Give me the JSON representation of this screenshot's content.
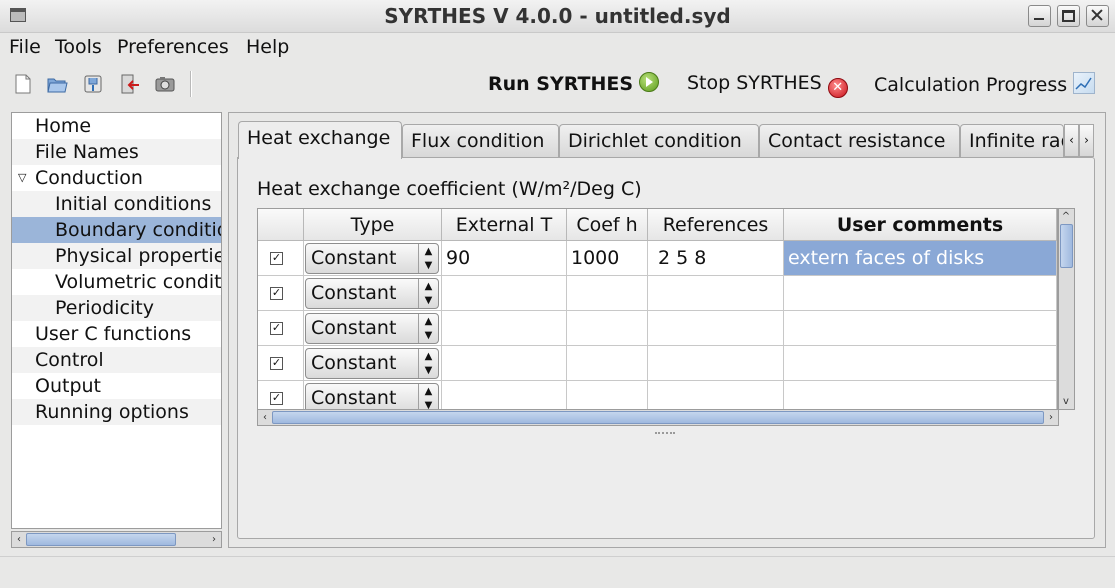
{
  "window": {
    "title": "SYRTHES V 4.0.0 - untitled.syd"
  },
  "menu": [
    "File",
    "Tools",
    "Preferences",
    "Help"
  ],
  "toolbar": {
    "icons": [
      "new-file-icon",
      "open-folder-icon",
      "save-icon",
      "exit-icon",
      "camera-icon"
    ],
    "run_label": "Run SYRTHES",
    "stop_label": "Stop SYRTHES",
    "progress_label": "Calculation Progress"
  },
  "tree": {
    "items": [
      {
        "label": "Home",
        "level": 0
      },
      {
        "label": "File Names",
        "level": 0
      },
      {
        "label": "Conduction",
        "level": 0,
        "expanded": true
      },
      {
        "label": "Initial conditions",
        "level": 1
      },
      {
        "label": "Boundary conditions",
        "level": 1,
        "selected": true
      },
      {
        "label": "Physical properties",
        "level": 1
      },
      {
        "label": "Volumetric conditions",
        "level": 1
      },
      {
        "label": "Periodicity",
        "level": 1
      },
      {
        "label": "User C functions",
        "level": 0
      },
      {
        "label": "Control",
        "level": 0
      },
      {
        "label": "Output",
        "level": 0
      },
      {
        "label": "Running options",
        "level": 0
      }
    ]
  },
  "tabs": [
    "Heat exchange",
    "Flux condition",
    "Dirichlet condition",
    "Contact resistance",
    "Infinite radiation"
  ],
  "active_tab": "Heat exchange",
  "section_label": "Heat exchange coefficient (W/m²/Deg C)",
  "table": {
    "columns": [
      "",
      "Type",
      "External T",
      "Coef h",
      "References",
      "User comments"
    ],
    "rows": [
      {
        "checked": true,
        "type": "Constant",
        "external_t": "90",
        "coef_h": "1000",
        "references": "2 5 8",
        "comment": "extern faces of disks"
      },
      {
        "checked": true,
        "type": "Constant",
        "external_t": "",
        "coef_h": "",
        "references": "",
        "comment": ""
      },
      {
        "checked": true,
        "type": "Constant",
        "external_t": "",
        "coef_h": "",
        "references": "",
        "comment": ""
      },
      {
        "checked": true,
        "type": "Constant",
        "external_t": "",
        "coef_h": "",
        "references": "",
        "comment": ""
      },
      {
        "checked": true,
        "type": "Constant",
        "external_t": "",
        "coef_h": "",
        "references": "",
        "comment": ""
      }
    ]
  },
  "colors": {
    "selection": "#9bb5d9",
    "row_highlight": "#8aa8d6"
  }
}
